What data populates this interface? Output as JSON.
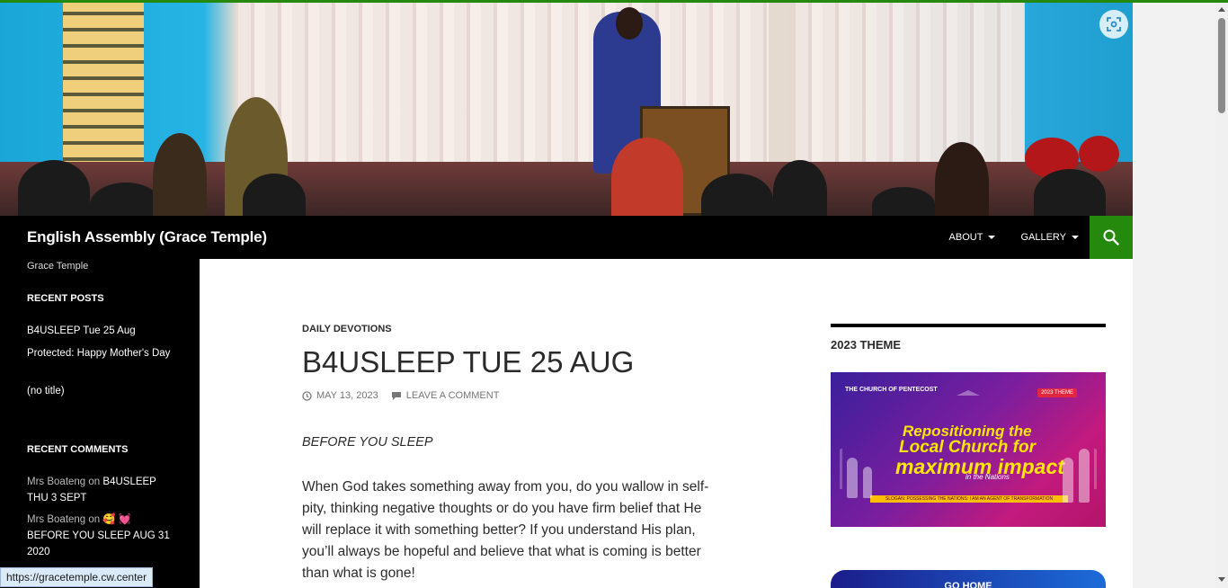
{
  "site": {
    "title": "English Assembly (Grace Temple)",
    "description": "Grace Temple",
    "nav": [
      {
        "label": "ABOUT"
      },
      {
        "label": "GALLERY"
      }
    ],
    "accent_color": "#24890d",
    "search_icon": "search-icon",
    "header_expand_icon": "expand-icon"
  },
  "sidebar": {
    "recent_posts_title": "RECENT POSTS",
    "recent_posts": [
      "B4USLEEP Tue 25 Aug",
      "Protected: Happy Mother's Day",
      "(no title)"
    ],
    "recent_comments_title": "RECENT COMMENTS",
    "recent_comments": [
      {
        "author": "Mrs Boateng",
        "on": "on",
        "post": "B4USLEEP THU 3 SEPT"
      },
      {
        "author": "Mrs Boateng",
        "on": "on",
        "post": "🥰 💓 BEFORE YOU SLEEP AUG 31 2020"
      }
    ]
  },
  "post": {
    "category": "DAILY DEVOTIONS",
    "title": "B4USLEEP TUE 25 AUG",
    "date": "MAY 13, 2023",
    "comment_link": "LEAVE A COMMENT",
    "intro": "BEFORE YOU SLEEP",
    "body": "When God takes something away from you, do you wallow in self-pity, thinking negative thoughts or do you have firm belief that He will replace it with something better? If you understand His plan, you’ll always be hopeful and believe that what is coming is better than what is gone!"
  },
  "right_widgets": {
    "theme_title": "2023 THEME",
    "banner": {
      "logo_text": "THE CHURCH OF PENTECOST",
      "tag": "2023 THEME",
      "line1": "Repositioning the",
      "line2": "Local Church for",
      "line3": "maximum impact",
      "line4": "in the Nations",
      "strip": "SLOGAN: POSSESSING THE NATIONS: I AM AN AGENT OF TRANSFORMATION"
    },
    "go_home": "GO HOME"
  },
  "status_bar": {
    "url": "https://gracetemple.cw.center"
  }
}
